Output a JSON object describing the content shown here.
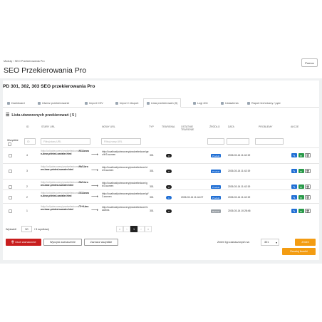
{
  "breadcrumb": {
    "home": "Moduły",
    "sep": "›",
    "current": "SEO Przekierowania Pro"
  },
  "page_title": "SEO Przekierowania Pro",
  "help_label": "Pomoc",
  "panel_title": "PD 301, 302, 303 SEO przekierowania Pro",
  "tabs": [
    "Dashboard",
    "Utwórz przekierowanie",
    "Import CSV",
    "Import / eksport",
    "Lista przekierowań (5)",
    "Logi 404",
    "Ustawienia",
    "Raport techniczny / pęki"
  ],
  "list_heading": "Lista utworzonych przekierowań ( 5 )",
  "columns": {
    "id": "ID",
    "start": "STARY URL",
    "new": "NOWY URL",
    "type": "TYP",
    "hits": "TRAFIENIA",
    "last": "OSTATNIE TRAFIENIE",
    "source": "ŹRÓDŁO",
    "date": "DATA",
    "problems": "PROBLEMY",
    "actions": "AKCJE"
  },
  "filters": {
    "all_label": "Wszystkie",
    "id_placeholder": "ID",
    "start_placeholder": "Filtruj stary URL",
    "new_placeholder": "Filtruj nowy URL"
  },
  "rows": [
    {
      "id": "4",
      "old_prefix": "/http://url/",
      "old_mid": "pdrecovery/pradzeitedcom/",
      "old_bold": "/6/3-brown-bear-printed-sweater.html",
      "new": "http://localhost/pdrecovery/pradzeitedcom/geo/fr/3-women",
      "type": "301",
      "hits": "0",
      "last": "",
      "source": "Produkt",
      "source_color": "#1f6ed4",
      "date": "2026-03-14 11:42:19"
    },
    {
      "id": "3",
      "old_prefix": "/http://url/",
      "old_mid": "pdrecovery/pradzeitedcom/",
      "old_bold": "/fb/3-brown-bear-printed-sweater.html",
      "new": "http://localhost/pdrecovery/pradzeitedcom/de/3-women",
      "type": "301",
      "hits": "0",
      "last": "",
      "source": "Produkt",
      "source_color": "#1f6ed4",
      "date": "2026-03-14 11:42:19"
    },
    {
      "id": "2",
      "old_prefix": "/http://url/",
      "old_mid": "pdrecovery/pradzeitedcom/",
      "old_bold": "/fb/3-brown-bear-printed-sweater.html",
      "new": "http://localhost/pdrecovery/pradzeitedcom/gb/3-women",
      "type": "301",
      "hits": "0",
      "last": "",
      "source": "Produkt",
      "source_color": "#1f6ed4",
      "date": "2026-03-14 11:42:19"
    },
    {
      "id": "2",
      "old_prefix": "/http://url/",
      "old_mid": "pdrecovery/pradzeitedcom/",
      "old_bold": "/2/3-brown-bear-printed-sweater.html",
      "new": "http://localhost/pdrecovery/pradzeitedcom/pl/3-women",
      "type": "301",
      "hits": "1",
      "last": "2026-03-14 11:44:07",
      "source": "Produkt",
      "source_color": "#1f6ed4",
      "date": "2026-03-14 11:42:19"
    },
    {
      "id": "1",
      "old_prefix": "/http://url/",
      "old_mid": "pdrecovery/pradzeitedcom/",
      "old_bold": "/7/+9-brown-bear-printed-sweater.html",
      "new": "http://localhost/pdrecovery/pradzeitedcom/3-clothes",
      "type": "301",
      "hits": "0",
      "last": "",
      "source": "Ręczne",
      "source_color": "#9aa0a6",
      "date": "2026-03-14 10:28:46"
    }
  ],
  "footer": {
    "show_label": "Wyświetl",
    "per_page": "50",
    "of_results": "/ 5 wyników)",
    "pages": [
      "«",
      "‹",
      "1",
      "›",
      "»"
    ]
  },
  "bulk": {
    "delete": "Usuń zaznaczone",
    "clear": "Wyczyść zaznaczenie",
    "select_all": "Zaznacz wszystkie",
    "change_type_label": "Zmień typ zaznaczonych na:",
    "type_value": "301",
    "change_btn": "Zmień",
    "remove_all": "Resetuj liczniki"
  }
}
